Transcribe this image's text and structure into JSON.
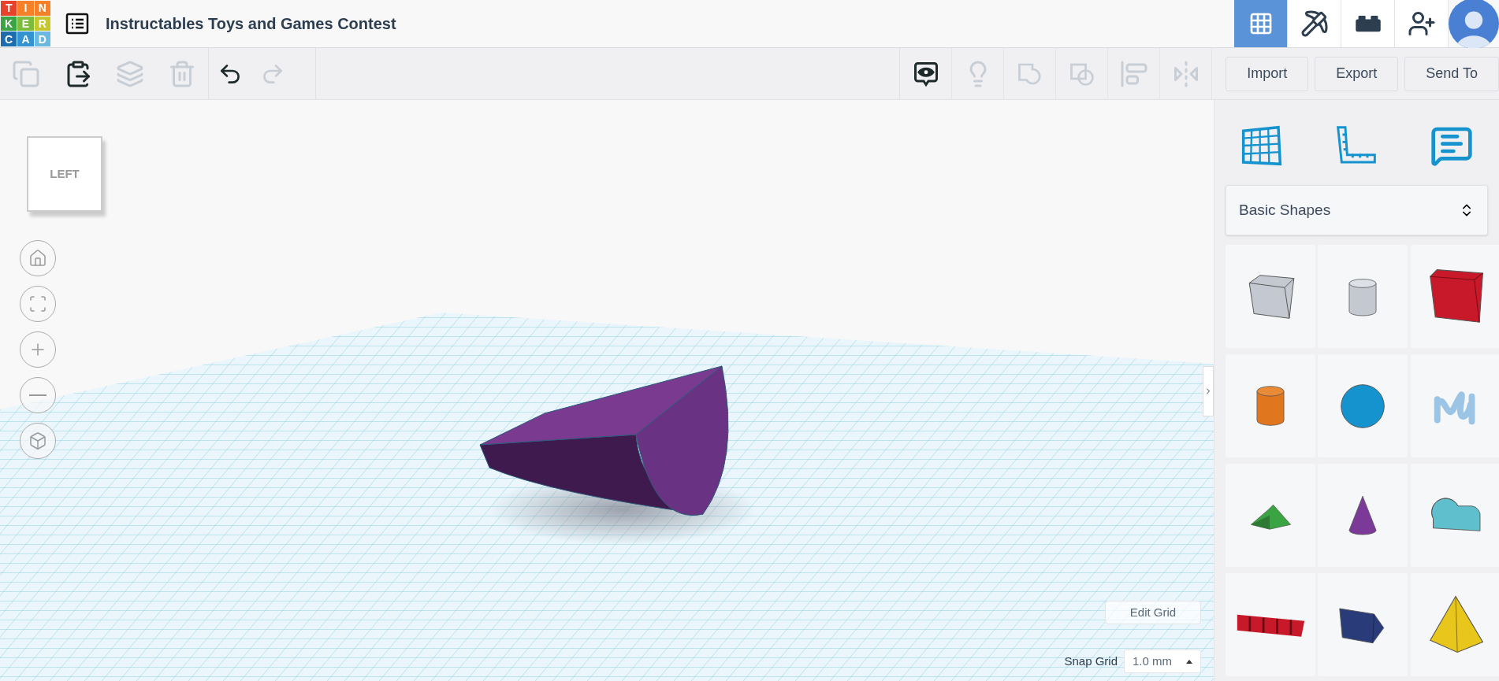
{
  "logo": [
    {
      "letter": "T",
      "color": "#e8412c"
    },
    {
      "letter": "I",
      "color": "#f4812a"
    },
    {
      "letter": "N",
      "color": "#f4812a"
    },
    {
      "letter": "K",
      "color": "#3aa443"
    },
    {
      "letter": "E",
      "color": "#7cbb3c"
    },
    {
      "letter": "R",
      "color": "#c6c72e"
    },
    {
      "letter": "C",
      "color": "#1c6cb0"
    },
    {
      "letter": "A",
      "color": "#3592d0"
    },
    {
      "letter": "D",
      "color": "#6bb8e0"
    }
  ],
  "title": "Instructables Toys and Games Contest",
  "view_switch": [
    {
      "kind": "grid",
      "selected": true
    },
    {
      "kind": "pickaxe",
      "selected": false
    },
    {
      "kind": "bricks",
      "selected": false
    }
  ],
  "edit_tools": [
    {
      "kind": "copy",
      "disabled": true
    },
    {
      "kind": "paste",
      "disabled": false
    },
    {
      "kind": "duplicate",
      "disabled": true
    },
    {
      "kind": "delete",
      "disabled": true
    }
  ],
  "history_tools": [
    {
      "kind": "undo",
      "disabled": false
    },
    {
      "kind": "redo",
      "disabled": true
    }
  ],
  "shape_tools": [
    {
      "kind": "notes",
      "disabled": false
    },
    {
      "kind": "light",
      "disabled": true
    },
    {
      "kind": "group",
      "disabled": true
    },
    {
      "kind": "ungroup",
      "disabled": true
    },
    {
      "kind": "align",
      "disabled": true
    },
    {
      "kind": "mirror",
      "disabled": true
    }
  ],
  "action_buttons": [
    "Import",
    "Export",
    "Send To"
  ],
  "view_cube": {
    "face_label": "LEFT"
  },
  "panel_tools": [
    {
      "kind": "workplane"
    },
    {
      "kind": "ruler"
    },
    {
      "kind": "notes"
    }
  ],
  "shape_library": {
    "value": "Basic Shapes"
  },
  "shapes": [
    {
      "kind": "box-hole",
      "color": "#c4c8d0"
    },
    {
      "kind": "cylinder-hole",
      "color": "#c4c8d0"
    },
    {
      "kind": "box",
      "color": "#c8192a"
    },
    {
      "kind": "cylinder",
      "color": "#e0771f"
    },
    {
      "kind": "sphere",
      "color": "#1493cf"
    },
    {
      "kind": "scribble",
      "color": "#9cc4e4"
    },
    {
      "kind": "roof",
      "color": "#3aa443"
    },
    {
      "kind": "cone",
      "color": "#7b3a98"
    },
    {
      "kind": "round-roof",
      "color": "#5fbfcc"
    },
    {
      "kind": "text",
      "color": "#c8192a"
    },
    {
      "kind": "wedge",
      "color": "#2a3b7a"
    },
    {
      "kind": "pyramid",
      "color": "#e8c61c"
    }
  ],
  "grid_controls": {
    "edit_label": "Edit Grid",
    "snap_label": "Snap Grid",
    "snap_value": "1.0 mm"
  }
}
